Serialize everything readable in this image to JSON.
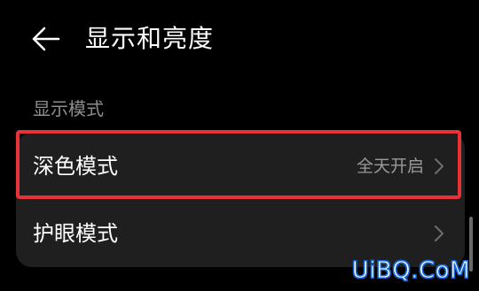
{
  "header": {
    "title": "显示和亮度",
    "back_icon": "arrow-left-icon"
  },
  "section": {
    "label": "显示模式"
  },
  "rows": [
    {
      "label": "深色模式",
      "value": "全天开启",
      "chevron_icon": "chevron-right-icon",
      "highlighted": true
    },
    {
      "label": "护眼模式",
      "value": "",
      "chevron_icon": "chevron-right-icon",
      "highlighted": false
    }
  ],
  "watermark": "UiBQ.CoM",
  "colors": {
    "background": "#000000",
    "card": "#1f1f1f",
    "text_primary": "#ffffff",
    "text_secondary": "#8c8c8c",
    "highlight": "#e8323a",
    "watermark_outline": "#1565d8"
  }
}
